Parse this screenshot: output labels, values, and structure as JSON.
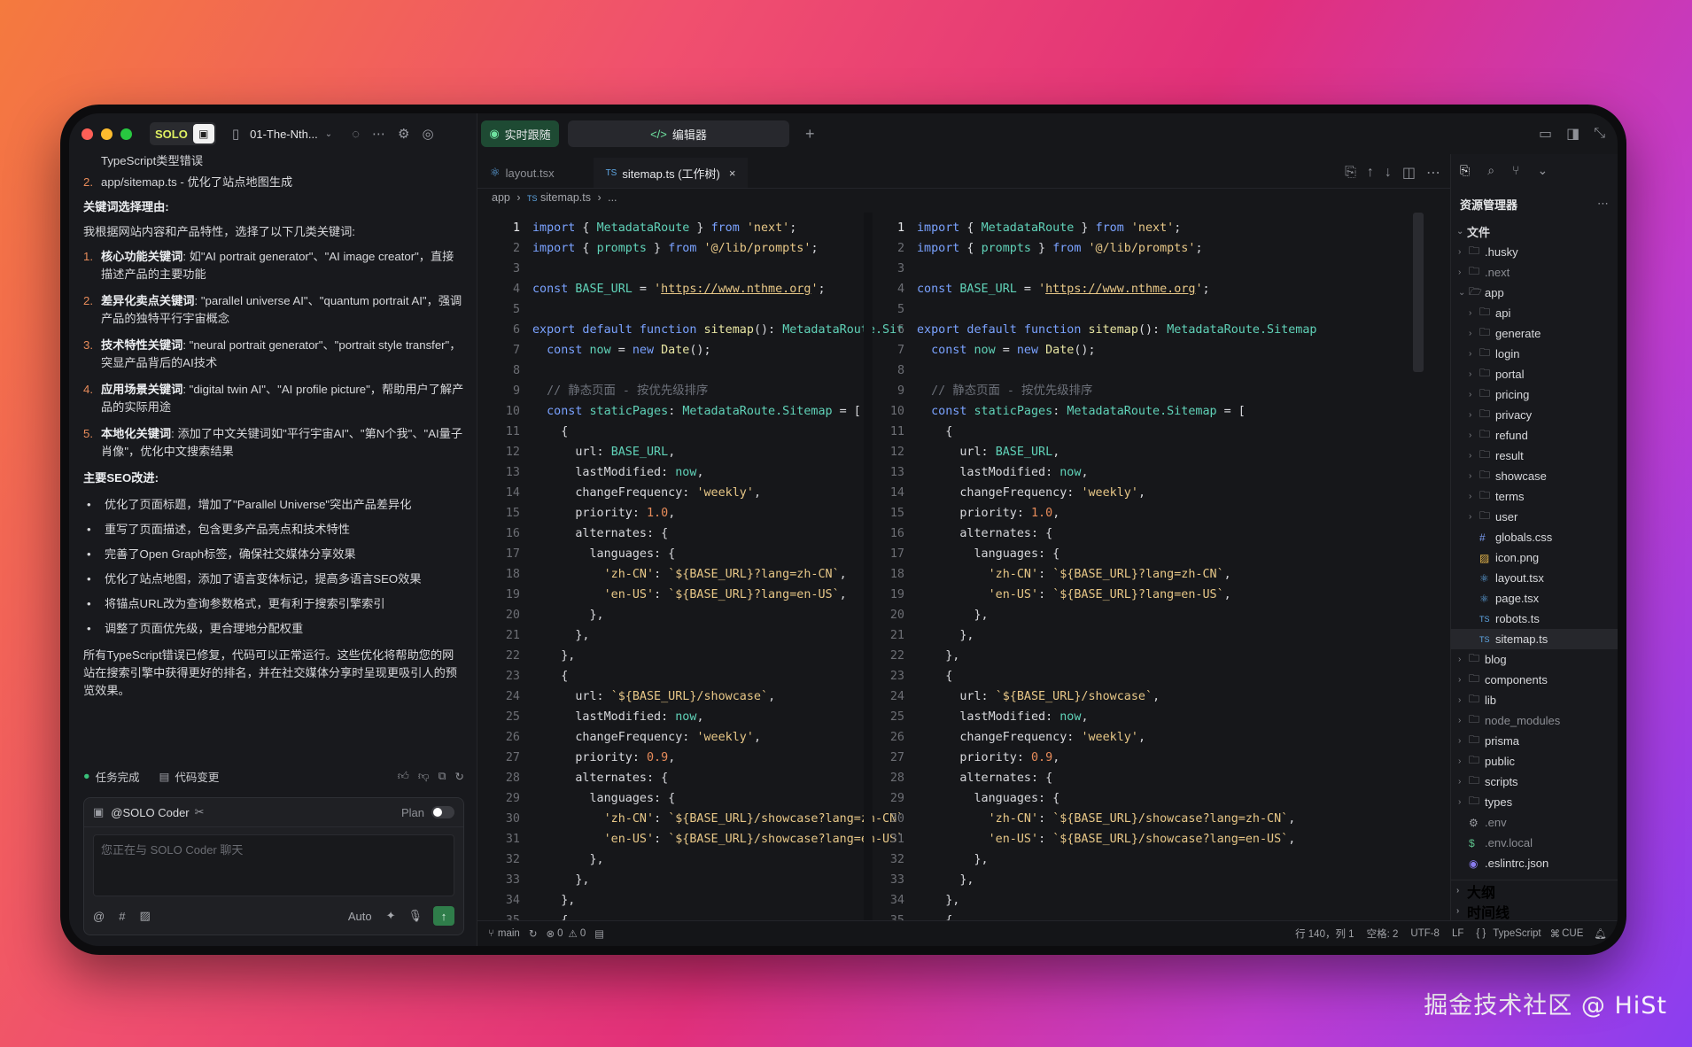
{
  "window": {
    "solo_badge": "SOLO",
    "project_name": "01-The-Nth...",
    "tabs": [
      "实时跟随",
      "编辑器"
    ],
    "add_tab": "+"
  },
  "chat": {
    "line1": "TypeScript类型错误",
    "line2_num": "2.",
    "line2": "app/sitemap.ts - 优化了站点地图生成",
    "kw_heading": "关键词选择理由:",
    "kw_intro": "我根据网站内容和产品特性，选择了以下几类关键词:",
    "kw_items": [
      {
        "num": "1.",
        "bold": "核心功能关键词",
        "text": ": 如\"AI portrait generator\"、\"AI image creator\"，直接描述产品的主要功能"
      },
      {
        "num": "2.",
        "bold": "差异化卖点关键词",
        "text": ": \"parallel universe AI\"、\"quantum portrait AI\"，强调产品的独特平行宇宙概念"
      },
      {
        "num": "3.",
        "bold": "技术特性关键词",
        "text": ": \"neural portrait generator\"、\"portrait style transfer\"，突显产品背后的AI技术"
      },
      {
        "num": "4.",
        "bold": "应用场景关键词",
        "text": ": \"digital twin AI\"、\"AI profile picture\"，帮助用户了解产品的实际用途"
      },
      {
        "num": "5.",
        "bold": "本地化关键词",
        "text": ": 添加了中文关键词如\"平行宇宙AI\"、\"第N个我\"、\"AI量子肖像\"，优化中文搜索结果"
      }
    ],
    "seo_heading": "主要SEO改进:",
    "seo_items": [
      "优化了页面标题，增加了\"Parallel Universe\"突出产品差异化",
      "重写了页面描述，包含更多产品亮点和技术特性",
      "完善了Open Graph标签，确保社交媒体分享效果",
      "优化了站点地图，添加了语言变体标记，提高多语言SEO效果",
      "将锚点URL改为查询参数格式，更有利于搜索引擎索引",
      "调整了页面优先级，更合理地分配权重"
    ],
    "summary": "所有TypeScript错误已修复，代码可以正常运行。这些优化将帮助您的网站在搜索引擎中获得更好的排名，并在社交媒体分享时呈现更吸引人的预览效果。",
    "task_done": "任务完成",
    "code_changes": "代码变更",
    "agent": "@SOLO Coder",
    "plan": "Plan",
    "input_placeholder": "您正在与 SOLO Coder 聊天",
    "mode": "Auto"
  },
  "editor": {
    "file_tabs": [
      "layout.tsx",
      "sitemap.ts (工作树)"
    ],
    "ts_tag": "TS",
    "breadcrumb": [
      "app",
      "sitemap.ts",
      "..."
    ],
    "line_numbers": [
      "1",
      "2",
      "3",
      "4",
      "5",
      "6",
      "7",
      "8",
      "9",
      "10",
      "11",
      "12",
      "13",
      "14",
      "15",
      "16",
      "17",
      "18",
      "19",
      "20",
      "21",
      "22",
      "23",
      "24",
      "25",
      "26",
      "27",
      "28",
      "29",
      "30",
      "31",
      "32",
      "33",
      "34",
      "35"
    ]
  },
  "explorer": {
    "title": "资源管理器",
    "section": "文件",
    "items": [
      {
        "label": ".husky",
        "kind": "folder",
        "depth": 0,
        "dim": false
      },
      {
        "label": ".next",
        "kind": "folder",
        "depth": 0,
        "dim": true
      },
      {
        "label": "app",
        "kind": "folder-open",
        "depth": 0,
        "dim": false
      },
      {
        "label": "api",
        "kind": "folder",
        "depth": 1,
        "dim": false
      },
      {
        "label": "generate",
        "kind": "folder",
        "depth": 1,
        "dim": false
      },
      {
        "label": "login",
        "kind": "folder",
        "depth": 1,
        "dim": false
      },
      {
        "label": "portal",
        "kind": "folder",
        "depth": 1,
        "dim": false
      },
      {
        "label": "pricing",
        "kind": "folder",
        "depth": 1,
        "dim": false
      },
      {
        "label": "privacy",
        "kind": "folder",
        "depth": 1,
        "dim": false
      },
      {
        "label": "refund",
        "kind": "folder",
        "depth": 1,
        "dim": false
      },
      {
        "label": "result",
        "kind": "folder",
        "depth": 1,
        "dim": false
      },
      {
        "label": "showcase",
        "kind": "folder",
        "depth": 1,
        "dim": false
      },
      {
        "label": "terms",
        "kind": "folder",
        "depth": 1,
        "dim": false
      },
      {
        "label": "user",
        "kind": "folder",
        "depth": 1,
        "dim": false
      },
      {
        "label": "globals.css",
        "kind": "css",
        "depth": 1,
        "dim": false
      },
      {
        "label": "icon.png",
        "kind": "img",
        "depth": 1,
        "dim": false
      },
      {
        "label": "layout.tsx",
        "kind": "react",
        "depth": 1,
        "dim": false
      },
      {
        "label": "page.tsx",
        "kind": "react",
        "depth": 1,
        "dim": false
      },
      {
        "label": "robots.ts",
        "kind": "ts",
        "depth": 1,
        "dim": false
      },
      {
        "label": "sitemap.ts",
        "kind": "ts",
        "depth": 1,
        "dim": false,
        "selected": true
      },
      {
        "label": "blog",
        "kind": "folder",
        "depth": 0,
        "dim": false
      },
      {
        "label": "components",
        "kind": "folder",
        "depth": 0,
        "dim": false
      },
      {
        "label": "lib",
        "kind": "folder",
        "depth": 0,
        "dim": false
      },
      {
        "label": "node_modules",
        "kind": "folder",
        "depth": 0,
        "dim": true
      },
      {
        "label": "prisma",
        "kind": "folder",
        "depth": 0,
        "dim": false
      },
      {
        "label": "public",
        "kind": "folder",
        "depth": 0,
        "dim": false
      },
      {
        "label": "scripts",
        "kind": "folder",
        "depth": 0,
        "dim": false
      },
      {
        "label": "types",
        "kind": "folder",
        "depth": 0,
        "dim": false
      },
      {
        "label": ".env",
        "kind": "gear",
        "depth": 0,
        "dim": true
      },
      {
        "label": ".env.local",
        "kind": "dollar",
        "depth": 0,
        "dim": true
      },
      {
        "label": ".eslintrc.json",
        "kind": "eslint",
        "depth": 0,
        "dim": false
      }
    ],
    "outline": "大纲",
    "timeline": "时间线"
  },
  "status": {
    "branch": "main",
    "errors": "0",
    "warnings": "0",
    "position": "行 140，列 1",
    "spaces": "空格: 2",
    "encoding": "UTF-8",
    "eol": "LF",
    "braces": "{ }",
    "language": "TypeScript",
    "cue": "CUE"
  },
  "watermark": "掘金技术社区 @ HiSt",
  "colors": {
    "accent_green": "#39c07a",
    "solo_yellow": "#dff062",
    "close": "#ff5f57",
    "min": "#febc2e",
    "max": "#28c840"
  }
}
